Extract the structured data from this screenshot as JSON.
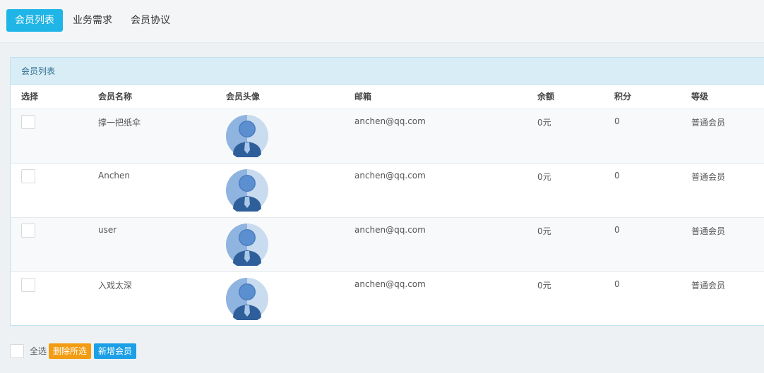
{
  "tabs": [
    {
      "label": "会员列表",
      "active": true
    },
    {
      "label": "业务需求",
      "active": false
    },
    {
      "label": "会员协议",
      "active": false
    }
  ],
  "panel": {
    "title": "会员列表"
  },
  "table": {
    "headers": [
      "选择",
      "会员名称",
      "会员头像",
      "邮箱",
      "余额",
      "积分",
      "等级"
    ],
    "rows": [
      {
        "name": "撑一把纸伞",
        "avatar": "user-avatar-icon",
        "email": "anchen@qq.com",
        "balance": "0元",
        "points": "0",
        "level": "普通会员"
      },
      {
        "name": "Anchen",
        "avatar": "user-avatar-icon",
        "email": "anchen@qq.com",
        "balance": "0元",
        "points": "0",
        "level": "普通会员"
      },
      {
        "name": "user",
        "avatar": "user-avatar-icon",
        "email": "anchen@qq.com",
        "balance": "0元",
        "points": "0",
        "level": "普通会员"
      },
      {
        "name": "入戏太深",
        "avatar": "user-avatar-icon",
        "email": "anchen@qq.com",
        "balance": "0元",
        "points": "0",
        "level": "普通会员"
      }
    ]
  },
  "footer": {
    "select_all_label": "全选",
    "delete_label": "删除所选",
    "add_label": "新增会员"
  },
  "colors": {
    "accent": "#1fb5e6",
    "panel_heading_bg": "#d9edf7",
    "delete_button": "#f39c12",
    "add_button": "#1b9fe6"
  }
}
